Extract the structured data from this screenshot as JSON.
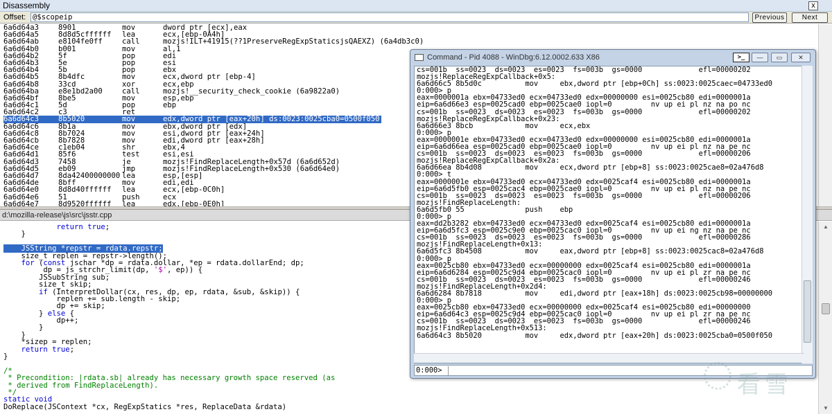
{
  "disassembly": {
    "title": "Disassembly",
    "close_label": "x",
    "offset_label": "Offset:",
    "offset_value": "@$scopeip",
    "previous_label": "Previous",
    "next_label": "Next",
    "lines": [
      {
        "addr": "6a6d64a3",
        "bytes": "8901",
        "mnem": "mov",
        "ops": "dword ptr [ecx],eax"
      },
      {
        "addr": "6a6d64a5",
        "bytes": "8d8d5cffffff",
        "mnem": "lea",
        "ops": "ecx,[ebp-0A4h]"
      },
      {
        "addr": "6a6d64ab",
        "bytes": "e8104fe0ff",
        "mnem": "call",
        "ops": "mozjs!ILT+41915(??1PreserveRegExpStaticsjsQAEXZ) (6a4db3c0)"
      },
      {
        "addr": "6a6d64b0",
        "bytes": "b001",
        "mnem": "mov",
        "ops": "al,1"
      },
      {
        "addr": "6a6d64b2",
        "bytes": "5f",
        "mnem": "pop",
        "ops": "edi"
      },
      {
        "addr": "6a6d64b3",
        "bytes": "5e",
        "mnem": "pop",
        "ops": "esi"
      },
      {
        "addr": "6a6d64b4",
        "bytes": "5b",
        "mnem": "pop",
        "ops": "ebx"
      },
      {
        "addr": "6a6d64b5",
        "bytes": "8b4dfc",
        "mnem": "mov",
        "ops": "ecx,dword ptr [ebp-4]"
      },
      {
        "addr": "6a6d64b8",
        "bytes": "33cd",
        "mnem": "xor",
        "ops": "ecx,ebp"
      },
      {
        "addr": "6a6d64ba",
        "bytes": "e8e1bd2a00",
        "mnem": "call",
        "ops": "mozjs!__security_check_cookie (6a9822a0)"
      },
      {
        "addr": "6a6d64bf",
        "bytes": "8be5",
        "mnem": "mov",
        "ops": "esp,ebp"
      },
      {
        "addr": "6a6d64c1",
        "bytes": "5d",
        "mnem": "pop",
        "ops": "ebp"
      },
      {
        "addr": "6a6d64c2",
        "bytes": "c3",
        "mnem": "ret",
        "ops": ""
      },
      {
        "addr": "6a6d64c3",
        "bytes": "8b5020",
        "mnem": "mov",
        "ops": "edx,dword ptr [eax+20h] ds:0023:0025cba0=0500f050",
        "highlight": true
      },
      {
        "addr": "6a6d64c6",
        "bytes": "8b1a",
        "mnem": "mov",
        "ops": "ebx,dword ptr [edx]"
      },
      {
        "addr": "6a6d64c8",
        "bytes": "8b7024",
        "mnem": "mov",
        "ops": "esi,dword ptr [eax+24h]"
      },
      {
        "addr": "6a6d64cb",
        "bytes": "8b7828",
        "mnem": "mov",
        "ops": "edi,dword ptr [eax+28h]"
      },
      {
        "addr": "6a6d64ce",
        "bytes": "c1eb04",
        "mnem": "shr",
        "ops": "ebx,4"
      },
      {
        "addr": "6a6d64d1",
        "bytes": "85f6",
        "mnem": "test",
        "ops": "esi,esi"
      },
      {
        "addr": "6a6d64d3",
        "bytes": "7458",
        "mnem": "je",
        "ops": "mozjs!FindReplaceLength+0x57d (6a6d652d)"
      },
      {
        "addr": "6a6d64d5",
        "bytes": "eb09",
        "mnem": "jmp",
        "ops": "mozjs!FindReplaceLength+0x530 (6a6d64e0)"
      },
      {
        "addr": "6a6d64d7",
        "bytes": "8da42400000000",
        "mnem": "lea",
        "ops": "esp,[esp]"
      },
      {
        "addr": "6a6d64de",
        "bytes": "8bff",
        "mnem": "mov",
        "ops": "edi,edi"
      },
      {
        "addr": "6a6d64e0",
        "bytes": "8d8d40ffffff",
        "mnem": "lea",
        "ops": "ecx,[ebp-0C0h]"
      },
      {
        "addr": "6a6d64e6",
        "bytes": "51",
        "mnem": "push",
        "ops": "ecx"
      },
      {
        "addr": "6a6d64e7",
        "bytes": "8d9520ffffff",
        "mnem": "lea",
        "ops": "edx,[ebp-0E0h]"
      }
    ]
  },
  "source": {
    "path": "d:\\mozilla-release\\js\\src\\jsstr.cpp",
    "lines": [
      [
        {
          "t": "            "
        },
        {
          "t": "return true",
          "c": "kw"
        },
        {
          "t": ";"
        }
      ],
      [
        {
          "t": "    }"
        }
      ],
      [
        {
          "t": ""
        }
      ],
      [
        {
          "t": "    JSString *repstr = rdata.repstr;",
          "hl": true
        }
      ],
      [
        {
          "t": "    size_t replen = repstr->length();"
        }
      ],
      [
        {
          "t": "    "
        },
        {
          "t": "for",
          "c": "kw"
        },
        {
          "t": " ("
        },
        {
          "t": "const",
          "c": "kw"
        },
        {
          "t": " jschar *dp = rdata.dollar, *ep = rdata.dollarEnd; dp;"
        }
      ],
      [
        {
          "t": "         dp = js_strchr_limit(dp, "
        },
        {
          "t": "'$'",
          "c": "st"
        },
        {
          "t": ", ep)) {"
        }
      ],
      [
        {
          "t": "        JSSubString sub;"
        }
      ],
      [
        {
          "t": "        size_t skip;"
        }
      ],
      [
        {
          "t": "        "
        },
        {
          "t": "if",
          "c": "kw"
        },
        {
          "t": " (InterpretDollar(cx, res, dp, ep, rdata, &sub, &skip)) {"
        }
      ],
      [
        {
          "t": "            replen += sub.length - skip;"
        }
      ],
      [
        {
          "t": "            dp += skip;"
        }
      ],
      [
        {
          "t": "        } "
        },
        {
          "t": "else",
          "c": "kw"
        },
        {
          "t": " {"
        }
      ],
      [
        {
          "t": "            dp++;"
        }
      ],
      [
        {
          "t": "        }"
        }
      ],
      [
        {
          "t": "    }"
        }
      ],
      [
        {
          "t": "    *sizep = replen;"
        }
      ],
      [
        {
          "t": "    "
        },
        {
          "t": "return true",
          "c": "kw"
        },
        {
          "t": ";"
        }
      ],
      [
        {
          "t": "}"
        }
      ],
      [
        {
          "t": ""
        }
      ],
      [
        {
          "t": "/*",
          "c": "cm"
        }
      ],
      [
        {
          "t": " * Precondition: |rdata.sb| already has necessary growth space reserved (as",
          "c": "cm"
        }
      ],
      [
        {
          "t": " * derived from FindReplaceLength).",
          "c": "cm"
        }
      ],
      [
        {
          "t": " */",
          "c": "cm"
        }
      ],
      [
        {
          "t": "static",
          "c": "kw"
        },
        {
          "t": " "
        },
        {
          "t": "void",
          "c": "kw"
        }
      ],
      [
        {
          "t": "DoReplace(JSContext *cx, RegExpStatics *res, ReplaceData &rdata)"
        }
      ]
    ]
  },
  "command": {
    "title": "Command - Pid 4088 - WinDbg:6.12.0002.633 X86",
    "term_button": ">_",
    "prompt": "0:000>",
    "input_value": "",
    "lines": [
      "cs=001b  ss=0023  ds=0023  es=0023  fs=003b  gs=0000             efl=00000202",
      "mozjs!ReplaceRegExpCallback+0x5:",
      "6a6d66c5 8b5d0c          mov     ebx,dword ptr [ebp+0Ch] ss:0023:0025caec=04733ed0",
      "0:000> p",
      "eax=0000001a ebx=04733ed0 ecx=04733ed0 edx=00000000 esi=0025cb80 edi=0000001a",
      "eip=6a6d66e3 esp=0025cad0 ebp=0025cae0 iopl=0         nv up ei pl nz na po nc",
      "cs=001b  ss=0023  ds=0023  es=0023  fs=003b  gs=0000             efl=00000202",
      "mozjs!ReplaceRegExpCallback+0x23:",
      "6a6d66e3 8bcb            mov     ecx,ebx",
      "0:000> p",
      "eax=0000001e ebx=04733ed0 ecx=04733ed0 edx=00000000 esi=0025cb80 edi=0000001a",
      "eip=6a6d66ea esp=0025cad0 ebp=0025cae0 iopl=0         nv up ei pl nz na pe nc",
      "cs=001b  ss=0023  ds=0023  es=0023  fs=003b  gs=0000             efl=00000206",
      "mozjs!ReplaceRegExpCallback+0x2a:",
      "6a6d66ea 8b4d08          mov     ecx,dword ptr [ebp+8] ss:0023:0025cae8=02a476d8",
      "0:000> t",
      "eax=0000001e ebx=04733ed0 ecx=04733ed0 edx=0025caf4 esi=0025cb80 edi=0000001a",
      "eip=6a6d5fb0 esp=0025cac4 ebp=0025cae0 iopl=0         nv up ei pl nz na pe nc",
      "cs=001b  ss=0023  ds=0023  es=0023  fs=003b  gs=0000             efl=00000206",
      "mozjs!FindReplaceLength:",
      "6a6d5fb0 55              push    ebp",
      "0:000> p",
      "eax=dd2b3282 ebx=04733ed0 ecx=04733ed0 edx=0025caf4 esi=0025cb80 edi=0000001a",
      "eip=6a6d5fc3 esp=0025c9e0 ebp=0025cac0 iopl=0         nv up ei ng nz na pe nc",
      "cs=001b  ss=0023  ds=0023  es=0023  fs=003b  gs=0000             efl=00000286",
      "mozjs!FindReplaceLength+0x13:",
      "6a6d5fc3 8b4508          mov     eax,dword ptr [ebp+8] ss:0023:0025cac8=02a476d8",
      "0:000> p",
      "eax=0025cb80 ebx=04733ed0 ecx=00000000 edx=0025caf4 esi=0025cb80 edi=0000001a",
      "eip=6a6d6284 esp=0025c9d4 ebp=0025cac0 iopl=0         nv up ei pl zr na pe nc",
      "cs=001b  ss=0023  ds=0023  es=0023  fs=003b  gs=0000             efl=00000246",
      "mozjs!FindReplaceLength+0x2d4:",
      "6a6d6284 8b7818          mov     edi,dword ptr [eax+18h] ds:0023:0025cb98=00000000",
      "0:000> p",
      "eax=0025cb80 ebx=04733ed0 ecx=00000000 edx=0025caf4 esi=0025cb80 edi=00000000",
      "eip=6a6d64c3 esp=0025c9d4 ebp=0025cac0 iopl=0         nv up ei pl zr na pe nc",
      "cs=001b  ss=0023  ds=0023  es=0023  fs=003b  gs=0000             efl=00000246",
      "mozjs!FindReplaceLength+0x513:",
      "6a6d64c3 8b5020          mov     edx,dword ptr [eax+20h] ds:0023:0025cba0=0500f050"
    ]
  },
  "watermark": {
    "text": "看雪"
  },
  "colors": {
    "highlight": "#316ac5",
    "keyword": "#0000d8",
    "comment": "#008000",
    "string": "#b000b0"
  }
}
